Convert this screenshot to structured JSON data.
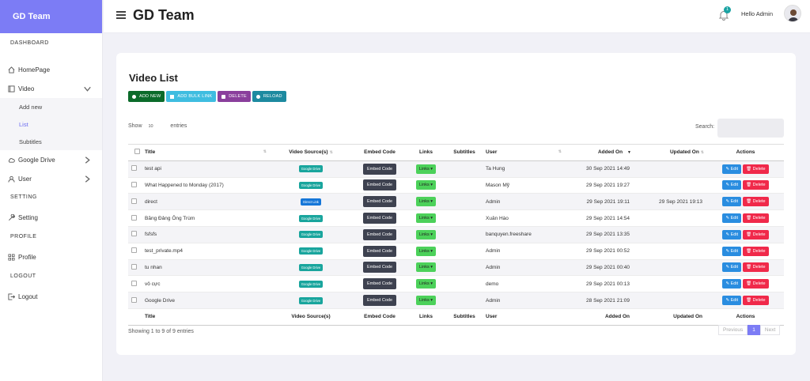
{
  "app": {
    "brand": "GD Team",
    "title": "GD Team",
    "notifications": "1",
    "greeting": "Hello Admin"
  },
  "sidebar": {
    "sections": {
      "dashboard": "DASHBOARD",
      "setting": "SETTING",
      "profile": "PROFILE",
      "logout": "LOGOUT"
    },
    "homepage": "HomePage",
    "video": "Video",
    "video_sub": [
      "Add new",
      "List",
      "Subtitles"
    ],
    "google_drive": "Google Drive",
    "user": "User",
    "setting": "Setting",
    "profile_item": "Profile",
    "logout_item": "Logout"
  },
  "page": {
    "title": "Video List",
    "buttons": {
      "add_new": "ADD NEW",
      "add_bulk": "ADD BULK LINK",
      "delete": "DELETE",
      "reload": "RELOAD"
    },
    "show_label": "Show",
    "show_value": "10",
    "entries_label": "entries",
    "search_label": "Search:",
    "info": "Showing 1 to 9 of 9 entries",
    "pager": {
      "previous": "Previous",
      "current": "1",
      "next": "Next"
    }
  },
  "table": {
    "headers": [
      "Title",
      "Video Source(s)",
      "Embed Code",
      "Links",
      "Subtitles",
      "User",
      "Added On",
      "Updated On",
      "Actions"
    ],
    "labels": {
      "embed": "Embed Code",
      "links": "Links ▾",
      "edit": "✎ Edit",
      "delete": "🗑 Delete"
    },
    "rows": [
      {
        "title": "test api",
        "source": "Google Drive",
        "user": "Ta Hung",
        "added": "30 Sep 2021 14:49",
        "updated": ""
      },
      {
        "title": "What Happened to Monday (2017)",
        "source": "Google Drive",
        "user": "Mason Mỹ",
        "added": "29 Sep 2021 19:27",
        "updated": ""
      },
      {
        "title": "direct",
        "source": "Direct Link",
        "user": "Admin",
        "added": "29 Sep 2021 19:11",
        "updated": "29 Sep 2021 19:13"
      },
      {
        "title": "Băng Đảng Ông Trùm",
        "source": "Google Drive",
        "user": "Xuân Hào",
        "added": "29 Sep 2021 14:54",
        "updated": ""
      },
      {
        "title": "fsfsfs",
        "source": "Google Drive",
        "user": "banquyen.freeshare",
        "added": "29 Sep 2021 13:35",
        "updated": ""
      },
      {
        "title": "test_private.mp4",
        "source": "Google Drive",
        "user": "Admin",
        "added": "29 Sep 2021 00:52",
        "updated": ""
      },
      {
        "title": "tu nhan",
        "source": "Google Drive",
        "user": "Admin",
        "added": "29 Sep 2021 00:40",
        "updated": ""
      },
      {
        "title": "vô cực",
        "source": "Google Drive",
        "user": "demo",
        "added": "29 Sep 2021 00:13",
        "updated": ""
      },
      {
        "title": "Google Drive",
        "source": "Google Drive",
        "user": "Admin",
        "added": "28 Sep 2021 21:09",
        "updated": ""
      }
    ]
  },
  "colors": {
    "brand": "#7c7cf5",
    "add_new": "#0b6b2a",
    "add_bulk": "#3fbde0",
    "delete": "#8a3f9c",
    "reload": "#1d8aa0",
    "google_drive_badge": "#19a59d",
    "direct_link_badge": "#1576d8"
  }
}
